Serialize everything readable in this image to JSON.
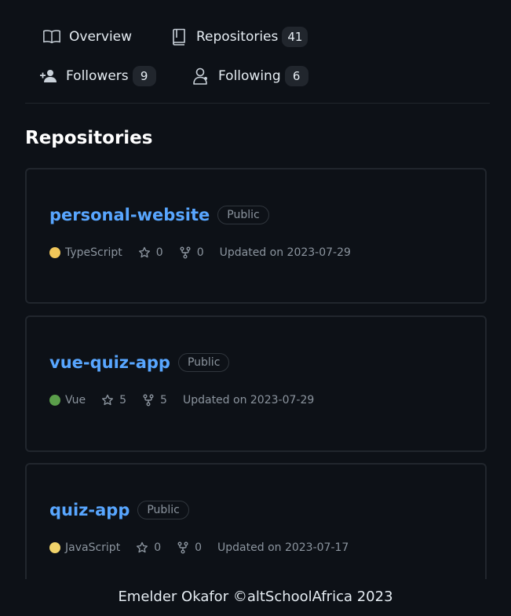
{
  "nav": {
    "overview": {
      "label": "Overview",
      "icon": "book-open-icon"
    },
    "repositories": {
      "label": "Repositories",
      "count": "41",
      "icon": "repo-icon"
    },
    "followers": {
      "label": "Followers",
      "count": "9",
      "icon": "person-add-icon"
    },
    "following": {
      "label": "Following",
      "count": "6",
      "icon": "people-icon"
    }
  },
  "section_title": "Repositories",
  "repos": [
    {
      "name": "personal-website",
      "visibility": "Public",
      "language": "TypeScript",
      "language_color": "#f1c75a",
      "stars": "0",
      "forks": "0",
      "updated": "Updated on 2023-07-29"
    },
    {
      "name": "vue-quiz-app",
      "visibility": "Public",
      "language": "Vue",
      "language_color": "#5a9e4a",
      "stars": "5",
      "forks": "5",
      "updated": "Updated on 2023-07-29"
    },
    {
      "name": "quiz-app",
      "visibility": "Public",
      "language": "JavaScript",
      "language_color": "#f1d36a",
      "stars": "0",
      "forks": "0",
      "updated": "Updated on 2023-07-17"
    }
  ],
  "footer": "Emelder Okafor ©altSchoolAfrica 2023",
  "colors": {
    "background": "#0d1117",
    "link": "#58a6ff",
    "border": "#21262d",
    "muted": "#8b949e"
  }
}
